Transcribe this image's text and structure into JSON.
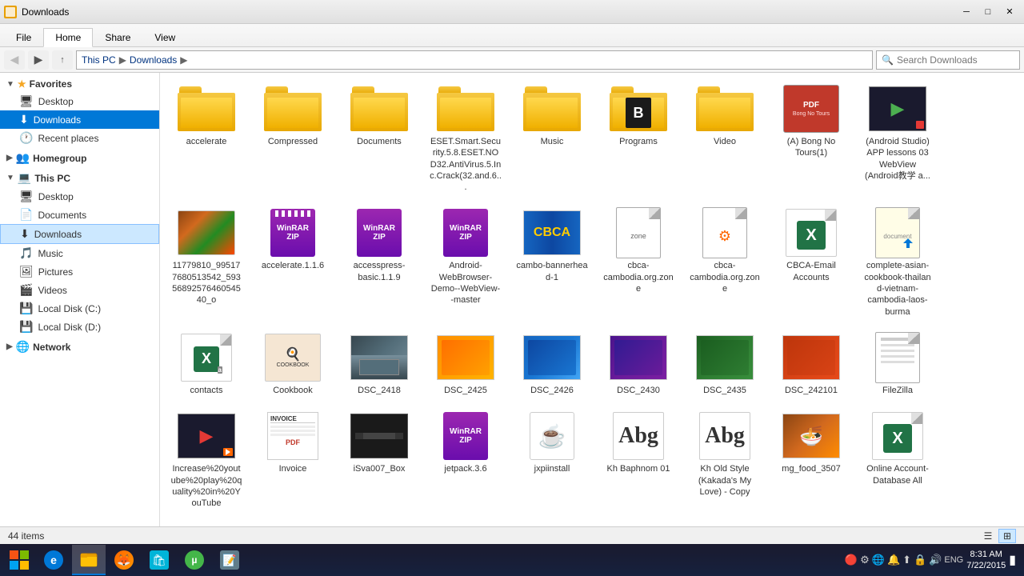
{
  "titleBar": {
    "title": "Downloads",
    "minBtn": "─",
    "maxBtn": "□",
    "closeBtn": "✕"
  },
  "ribbon": {
    "tabs": [
      "File",
      "Home",
      "Share",
      "View"
    ],
    "activeTab": "Home"
  },
  "addressBar": {
    "backBtn": "◀",
    "forwardBtn": "▶",
    "upBtn": "↑",
    "path": [
      "This PC",
      "Downloads"
    ],
    "searchPlaceholder": "Search Downloads"
  },
  "sidebar": {
    "sections": [
      {
        "name": "Favorites",
        "expanded": true,
        "items": [
          {
            "label": "Desktop",
            "active": false
          },
          {
            "label": "Downloads",
            "active": true,
            "selected": true
          },
          {
            "label": "Recent places",
            "active": false
          }
        ]
      },
      {
        "name": "Homegroup",
        "expanded": false,
        "items": []
      },
      {
        "name": "This PC",
        "expanded": true,
        "items": [
          {
            "label": "Desktop",
            "active": false
          },
          {
            "label": "Documents",
            "active": false
          },
          {
            "label": "Downloads",
            "active": true
          },
          {
            "label": "Music",
            "active": false
          },
          {
            "label": "Pictures",
            "active": false
          },
          {
            "label": "Videos",
            "active": false
          },
          {
            "label": "Local Disk (C:)",
            "active": false
          },
          {
            "label": "Local Disk (D:)",
            "active": false
          }
        ]
      },
      {
        "name": "Network",
        "expanded": false,
        "items": []
      }
    ]
  },
  "files": [
    {
      "id": 1,
      "name": "accelerate",
      "type": "folder"
    },
    {
      "id": 2,
      "name": "Compressed",
      "type": "folder"
    },
    {
      "id": 3,
      "name": "Documents",
      "type": "folder"
    },
    {
      "id": 4,
      "name": "ESET.Smart.Security.5.8.ESET.NOD32.AntiVirus.5.Inc.Crack(32.and.6...",
      "type": "folder"
    },
    {
      "id": 5,
      "name": "Music",
      "type": "folder"
    },
    {
      "id": 6,
      "name": "Programs",
      "type": "folder-special"
    },
    {
      "id": 7,
      "name": "Video",
      "type": "folder"
    },
    {
      "id": 8,
      "name": "(A) Bong No Tours(1)",
      "type": "pdf"
    },
    {
      "id": 9,
      "name": "(Android Studio) APP lessons 03 WebView (Android教学 a...",
      "type": "video-thumb"
    },
    {
      "id": 10,
      "name": "11779810_995177680513542_59356 89257646054540_o",
      "type": "image-food"
    },
    {
      "id": 11,
      "name": "accelerate.1.1.6",
      "type": "archive"
    },
    {
      "id": 12,
      "name": "accesspress-basic.1.1.9",
      "type": "archive2"
    },
    {
      "id": 13,
      "name": "Android-WebBrowser-Demo--WebView--master",
      "type": "archive3"
    },
    {
      "id": 14,
      "name": "cambo-bannerhea d-1",
      "type": "image-banner"
    },
    {
      "id": 15,
      "name": "cbca-cambodia.org.zone",
      "type": "doc-white"
    },
    {
      "id": 16,
      "name": "cbca-cambodia.org.zone",
      "type": "doc-with-icon"
    },
    {
      "id": 17,
      "name": "CBCA-Email Accounts",
      "type": "excel"
    },
    {
      "id": 18,
      "name": "complete-asian-cookbook-thailan d-vietnam-cambodia-laos-burma",
      "type": "doc-yellow"
    },
    {
      "id": 19,
      "name": "contacts",
      "type": "excel-contacts"
    },
    {
      "id": 20,
      "name": "Cookbook",
      "type": "pdf-cookbook"
    },
    {
      "id": 21,
      "name": "DSC_2418",
      "type": "photo"
    },
    {
      "id": 22,
      "name": "DSC_2425",
      "type": "photo"
    },
    {
      "id": 23,
      "name": "DSC_2426",
      "type": "photo"
    },
    {
      "id": 24,
      "name": "DSC_2430",
      "type": "photo"
    },
    {
      "id": 25,
      "name": "DSC_2435",
      "type": "photo"
    },
    {
      "id": 26,
      "name": "DSC_242101",
      "type": "photo"
    },
    {
      "id": 27,
      "name": "FileZilla",
      "type": "doc-lined"
    },
    {
      "id": 28,
      "name": "Increase%20youtube%20play%20quality%20in%20YouTube",
      "type": "video-thumb2"
    },
    {
      "id": 29,
      "name": "Invoice",
      "type": "pdf-invoice"
    },
    {
      "id": 30,
      "name": "iSva007_Box",
      "type": "image-dark"
    },
    {
      "id": 31,
      "name": "jetpack.3.6",
      "type": "archive4"
    },
    {
      "id": 32,
      "name": "jxpiinstall",
      "type": "java-icon"
    },
    {
      "id": 33,
      "name": "Kh Baphnom 01",
      "type": "font"
    },
    {
      "id": 34,
      "name": "Kh Old Style (Kakada's My Love) - Copy",
      "type": "font"
    },
    {
      "id": 35,
      "name": "mg_food_3507",
      "type": "food-photo"
    },
    {
      "id": 36,
      "name": "Online Account-Database All",
      "type": "excel2"
    }
  ],
  "statusBar": {
    "itemCount": "44 items"
  },
  "taskbar": {
    "time": "8:31 AM",
    "date": "7/22/2015",
    "language": "ENG",
    "apps": [
      "⊞",
      "🌐",
      "📁",
      "🦊",
      "🛍",
      "▪",
      "🔽",
      "📝"
    ]
  }
}
